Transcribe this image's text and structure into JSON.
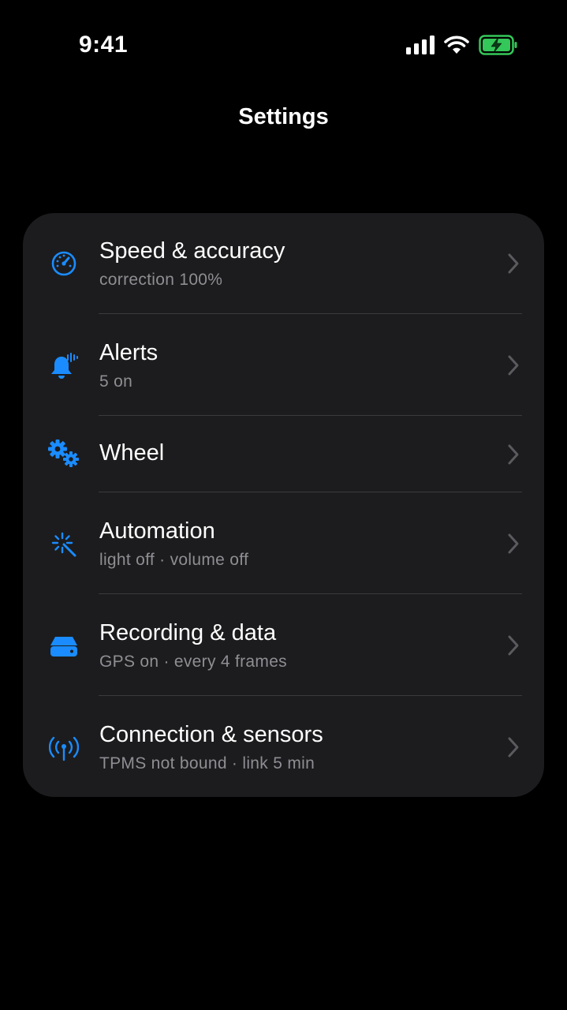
{
  "status_bar": {
    "time": "9:41",
    "icons": [
      "cellular-signal-icon",
      "wifi-icon",
      "battery-charging-icon"
    ],
    "battery_color": "#34c759"
  },
  "header": {
    "title": "Settings"
  },
  "accent_color": "#1a8cff",
  "settings": {
    "items": [
      {
        "icon": "speedometer-icon",
        "title": "Speed & accuracy",
        "subtitle": "correction 100%"
      },
      {
        "icon": "bell-alert-icon",
        "title": "Alerts",
        "subtitle": "5 on"
      },
      {
        "icon": "gears-icon",
        "title": "Wheel",
        "subtitle": ""
      },
      {
        "icon": "sparkle-wand-icon",
        "title": "Automation",
        "subtitle": "light off · volume off"
      },
      {
        "icon": "storage-drive-icon",
        "title": "Recording & data",
        "subtitle": "GPS on · every 4 frames"
      },
      {
        "icon": "antenna-signal-icon",
        "title": "Connection & sensors",
        "subtitle": "TPMS not bound · link 5 min"
      }
    ]
  }
}
